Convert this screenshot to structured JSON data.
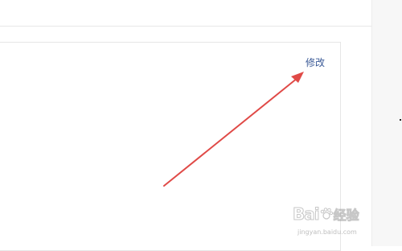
{
  "content": {
    "edit_link_label": "修改"
  },
  "annotation": {
    "arrow_color": "#e04a47"
  },
  "watermark": {
    "logo_text": "Bai",
    "logo_cn": "经验",
    "url": "jingyan.baidu.com"
  }
}
